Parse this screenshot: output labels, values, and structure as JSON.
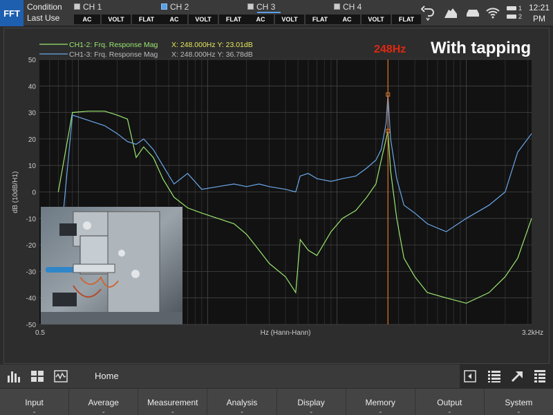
{
  "topbar": {
    "mode": "FFT",
    "condition_label": "Condition",
    "condition_value": "Last Use",
    "channels": [
      {
        "name": "CH 1",
        "coupling": "AC",
        "unit": "VOLT",
        "filter": "FLAT",
        "active": false
      },
      {
        "name": "CH 2",
        "coupling": "AC",
        "unit": "VOLT",
        "filter": "FLAT",
        "active": true
      },
      {
        "name": "CH 3",
        "coupling": "AC",
        "unit": "VOLT",
        "filter": "FLAT",
        "active": false
      },
      {
        "name": "CH 4",
        "coupling": "AC",
        "unit": "VOLT",
        "filter": "FLAT",
        "active": false
      }
    ],
    "battery_labels": [
      "1",
      "2"
    ],
    "time": "12:21",
    "ampm": "PM"
  },
  "chart": {
    "legend": [
      {
        "text": "CH1-2: Frq. Response Mag",
        "readout": "X: 248.000Hz Y: 23.01dB",
        "color": "#9be870"
      },
      {
        "text": "CH1-3: Frq. Response Mag",
        "readout": "X: 248.000Hz Y: 36.78dB",
        "color": "#6aa8ea"
      }
    ],
    "marker_label": "248Hz",
    "overlay_title": "With tapping",
    "photo_label": "test fixture photo"
  },
  "chart_data": {
    "type": "line",
    "xlabel": "Hz (Hann-Hann)",
    "ylabel": "dB (10dB/H1)",
    "x_scale": "log",
    "xlim": [
      0.5,
      3200
    ],
    "x_tick_labels": [
      "0.5",
      "3.2kHz"
    ],
    "ylim": [
      -50,
      50
    ],
    "y_ticks": [
      50,
      40,
      30,
      20,
      10,
      0,
      -10,
      -20,
      -30,
      -40,
      -50
    ],
    "grid": true,
    "marker_x": 248,
    "series": [
      {
        "name": "CH1-2: Frq. Response Mag",
        "color": "#9be870",
        "x": [
          0.7,
          0.9,
          1.2,
          1.6,
          2.0,
          2.4,
          2.8,
          3.2,
          3.8,
          4.5,
          5.5,
          7,
          9,
          12,
          16,
          20,
          25,
          30,
          40,
          48,
          52,
          60,
          70,
          90,
          110,
          140,
          170,
          200,
          220,
          240,
          248,
          260,
          290,
          330,
          400,
          500,
          700,
          1000,
          1500,
          2000,
          2500,
          3200
        ],
        "y": [
          0,
          30,
          30.5,
          30.5,
          29,
          27.5,
          13,
          17,
          13,
          5,
          -2,
          -6,
          -8,
          -10,
          -12,
          -16,
          -22,
          -27,
          -32,
          -38,
          -18,
          -22,
          -24,
          -15,
          -10,
          -7,
          -2,
          3,
          12,
          20,
          23.01,
          8,
          -10,
          -25,
          -32,
          -38,
          -40,
          -42,
          -38,
          -32,
          -25,
          -10
        ]
      },
      {
        "name": "CH1-3: Frq. Response Mag",
        "color": "#6aa8ea",
        "x": [
          0.7,
          0.9,
          1.2,
          1.6,
          2.0,
          2.4,
          2.8,
          3.2,
          3.8,
          4.5,
          5.5,
          7,
          9,
          12,
          16,
          20,
          25,
          30,
          40,
          48,
          52,
          60,
          70,
          90,
          110,
          140,
          170,
          200,
          220,
          240,
          248,
          260,
          290,
          330,
          400,
          500,
          700,
          1000,
          1500,
          2000,
          2500,
          3200
        ],
        "y": [
          -28,
          29,
          27,
          25,
          22,
          19,
          18,
          20,
          16,
          10,
          3,
          7,
          1,
          2,
          3,
          2,
          3,
          2,
          1,
          0,
          6,
          7,
          5,
          4,
          5,
          6,
          9,
          12,
          16,
          26,
          36.78,
          20,
          5,
          -5,
          -8,
          -12,
          -15,
          -10,
          -5,
          0,
          15,
          22
        ]
      }
    ]
  },
  "toolbar": {
    "home_label": "Home"
  },
  "menu": [
    "Input",
    "Average",
    "Measurement",
    "Analysis",
    "Display",
    "Memory",
    "Output",
    "System"
  ]
}
